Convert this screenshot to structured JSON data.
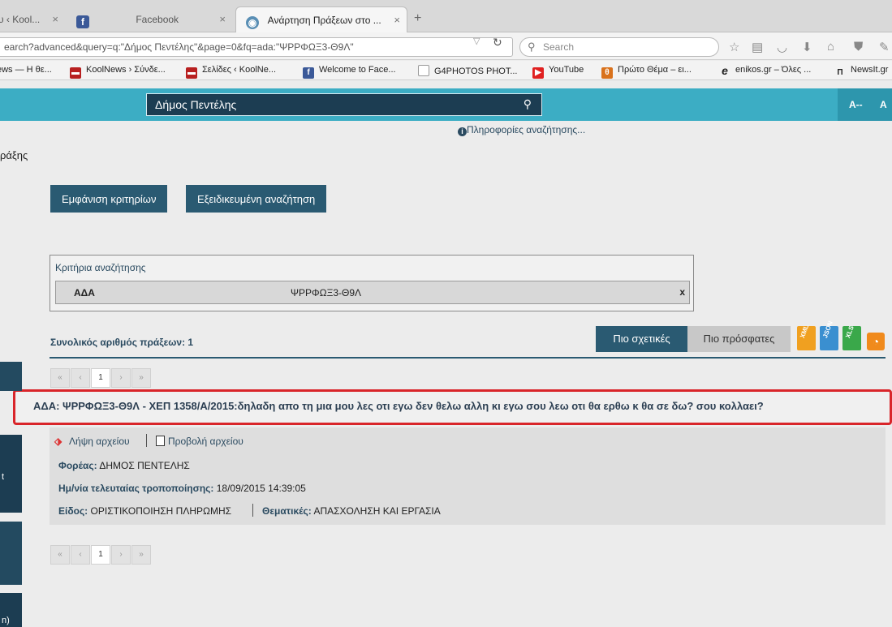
{
  "browser": {
    "tabs": [
      {
        "label": "υ ‹ Kool...",
        "close": "×"
      },
      {
        "label": "Facebook",
        "close": "×"
      },
      {
        "label": "Ανάρτηση Πράξεων στο ...",
        "close": "×"
      }
    ],
    "new_tab": "+",
    "url": "earch?advanced&query=q:\"Δήμος Πεντέλης\"&page=0&fq=ada:\"ΨΡΡΦΩΞ3-Θ9Λ\"",
    "search_placeholder": "Search",
    "bookmarks": [
      "ews — Η θε...",
      "KoolNews › Σύνδε...",
      "Σελίδες ‹ KoolNe...",
      "Welcome to Face...",
      "G4PHOTOS PHOT...",
      "YouTube",
      "Πρώτο Θέμα – ει...",
      "enikos.gr – Όλες ...",
      "NewsIt.gr"
    ]
  },
  "site": {
    "search_value": "Δήμος Πεντέλης",
    "font_decrease": "A--",
    "font_normal": "A",
    "info_link": "Πληροφορίες αναζήτησης...",
    "page_heading": "ράξης",
    "show_criteria_button": "Εμφάνιση κριτηρίων",
    "advanced_search_button": "Εξειδικευμένη αναζήτηση",
    "criteria": {
      "label": "Κριτήρια αναζήτησης",
      "key": "ΑΔΑ",
      "value": "ΨΡΡΦΩΞ3-Θ9Λ",
      "remove": "x"
    },
    "total_label": "Συνολικός αριθμός πράξεων: 1",
    "sort_relevant": "Πιο σχετικές",
    "sort_recent": "Πιο πρόσφατες",
    "formats": [
      "XML",
      "JSON",
      "XLS"
    ],
    "pager": [
      "«",
      "‹",
      "1",
      "›",
      "»"
    ],
    "result": {
      "title": "ΑΔΑ: ΨΡΡΦΩΞ3-Θ9Λ - ΧΕΠ 1358/Α/2015:δηλαδη απο τη μια μου λες οτι εγω δεν θελω αλλη κι εγω σου λεω οτι θα ερθω κ θα σε δω? σου κολλαει?",
      "download": "Λήψη αρχείου",
      "view": "Προβολή αρχείου",
      "org_label": "Φορέας:",
      "org_value": "ΔΗΜΟΣ ΠΕΝΤΕΛΗΣ",
      "modified_label": "Ημ/νία τελευταίας τροποποίησης:",
      "modified_value": "18/09/2015 14:39:05",
      "type_label": "Είδος:",
      "type_value": "ΟΡΙΣΤΙΚΟΠΟΙΗΣΗ ΠΛΗΡΩΜΗΣ",
      "topics_label": "Θεματικές:",
      "topics_value": "ΑΠΑΣΧΟΛΗΣΗ ΚΑΙ ΕΡΓΑΣΙΑ"
    },
    "left_tab_letters": [
      "t",
      "n)"
    ]
  },
  "colors": {
    "header": "#3cadc4",
    "dark_button": "#2a5a72",
    "highlight_border": "#d9252a"
  }
}
